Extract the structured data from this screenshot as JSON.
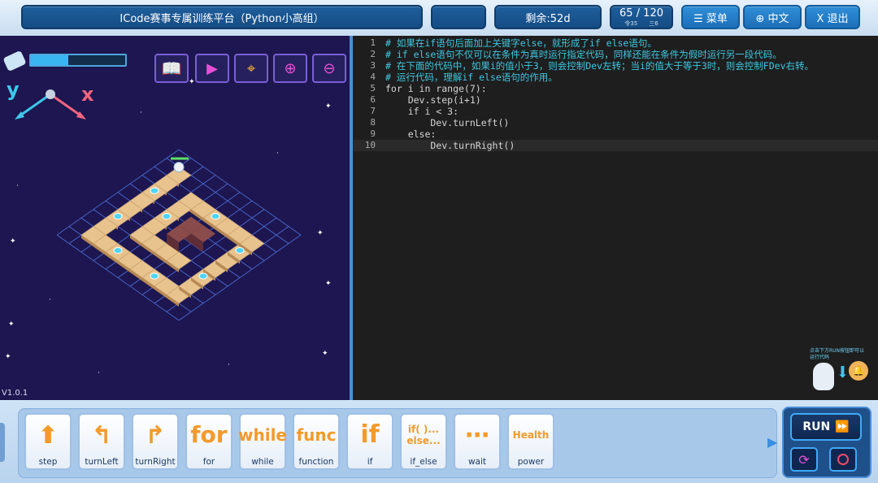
{
  "topbar": {
    "title": "ICode赛事专属训练平台（Python小高组）",
    "remaining": "剩余:52d",
    "progress": "65 / 120",
    "progress_sub_a": "令35",
    "progress_sub_b": "三6",
    "menu_label": "☰ 菜单",
    "lang_label": "⊕ 中文",
    "exit_label": "X 退出"
  },
  "game": {
    "axis_y": "y",
    "axis_x": "x",
    "version": "V1.0.1",
    "energy_level": 0.4,
    "hint": "点击下方RUN按钮即可以运行代码"
  },
  "editor": {
    "lines": [
      {
        "n": "1",
        "text": "# 如果在if语句后面加上关键字else，就形成了if else语句。"
      },
      {
        "n": "2",
        "text": "# if else语句不仅可以在条件为真时运行指定代码，同样还能在条件为假时运行另一段代码。"
      },
      {
        "n": "3",
        "text": "# 在下面的代码中，如果i的值小于3，则会控制Dev左转；当i的值大于等于3时，则会控制FDev右转。"
      },
      {
        "n": "4",
        "text": "# 运行代码，理解if else语句的作用。"
      },
      {
        "n": "5",
        "text": "for i in range(7):"
      },
      {
        "n": "6",
        "text": "    Dev.step(i+1)"
      },
      {
        "n": "7",
        "text": "    if i < 3:"
      },
      {
        "n": "8",
        "text": "        Dev.turnLeft()"
      },
      {
        "n": "9",
        "text": "    else:"
      },
      {
        "n": "10",
        "text": "        Dev.turnRight()"
      }
    ]
  },
  "blocks": [
    {
      "label": "step",
      "icon": "step-icon"
    },
    {
      "label": "turnLeft",
      "icon": "turn-left-icon"
    },
    {
      "label": "turnRight",
      "icon": "turn-right-icon"
    },
    {
      "label": "for",
      "icon": "for",
      "icon_text": "for"
    },
    {
      "label": "while",
      "icon": "while",
      "icon_text": "while"
    },
    {
      "label": "function",
      "icon": "func",
      "icon_text": "func"
    },
    {
      "label": "if",
      "icon": "if",
      "icon_text": "if"
    },
    {
      "label": "if_else",
      "icon": "if-else",
      "icon_text": "if( )...\nelse..."
    },
    {
      "label": "wait",
      "icon": "wait-icon"
    },
    {
      "label": "power",
      "icon": "power-icon",
      "icon_text": "Health"
    }
  ],
  "run": {
    "label": "RUN"
  },
  "colors": {
    "accent": "#f39a2b",
    "panel": "#1d1650",
    "editor_bg": "#1e1e1e",
    "comment": "#3ec7e0"
  }
}
